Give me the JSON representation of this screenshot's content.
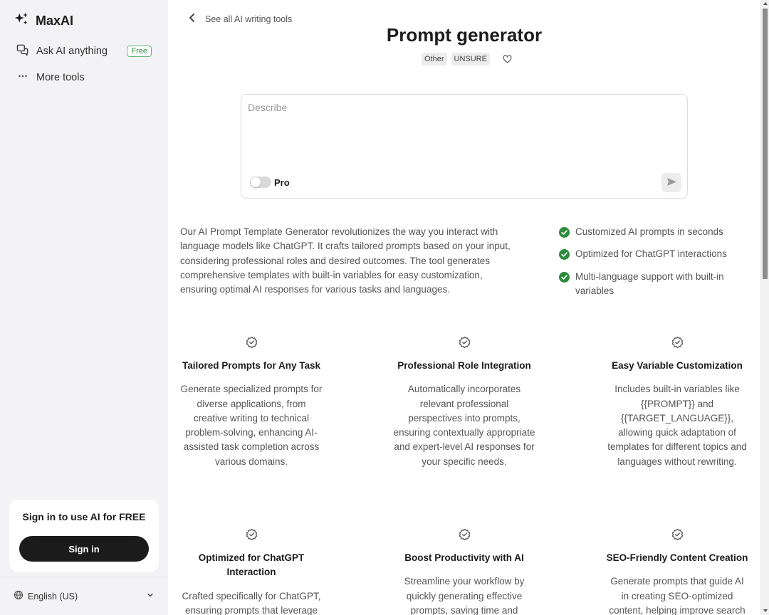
{
  "sidebar": {
    "brand": "MaxAI",
    "nav": [
      {
        "label": "Ask AI anything",
        "badge": "Free"
      },
      {
        "label": "More tools"
      }
    ],
    "signin": {
      "title": "Sign in to use AI for FREE",
      "button": "Sign in"
    },
    "language": "English (US)"
  },
  "header": {
    "back_label": "See all AI writing tools",
    "title": "Prompt generator",
    "tags": [
      "Other",
      "UNSURE"
    ]
  },
  "prompt": {
    "placeholder": "Describe",
    "value": "",
    "pro_label": "Pro",
    "pro_enabled": false
  },
  "intro": "Our AI Prompt Template Generator revolutionizes the way you interact with language models like ChatGPT. It crafts tailored prompts based on your input, considering professional roles and desired outcomes. The tool generates comprehensive templates with built-in variables for easy customization, ensuring optimal AI responses for various tasks and languages.",
  "checklist": [
    "Customized AI prompts in seconds",
    "Optimized for ChatGPT interactions",
    "Multi-language support with built-in variables"
  ],
  "features": [
    {
      "title": "Tailored Prompts for Any Task",
      "desc": "Generate specialized prompts for diverse applications, from creative writing to technical problem-solving, enhancing AI-assisted task completion across various domains."
    },
    {
      "title": "Professional Role Integration",
      "desc": "Automatically incorporates relevant professional perspectives into prompts, ensuring contextually appropriate and expert-level AI responses for your specific needs."
    },
    {
      "title": "Easy Variable Customization",
      "desc": "Includes built-in variables like {{PROMPT}} and {{TARGET_LANGUAGE}}, allowing quick adaptation of templates for different topics and languages without rewriting."
    },
    {
      "title": "Optimized for ChatGPT Interaction",
      "desc": "Crafted specifically for ChatGPT, ensuring prompts that leverage"
    },
    {
      "title": "Boost Productivity with AI",
      "desc": "Streamline your workflow by quickly generating effective prompts, saving time and"
    },
    {
      "title": "SEO-Friendly Content Creation",
      "desc": "Generate prompts that guide AI in creating SEO-optimized content, helping improve search"
    }
  ],
  "colors": {
    "sidebar_bg": "#f3f3f5",
    "check_green": "#2e8b3e",
    "button_dark": "#1b1b1b"
  },
  "icons": {
    "brand": "sparkles-icon",
    "ask": "chat-icon",
    "more": "ellipsis-icon",
    "back": "chevron-left-icon",
    "favorite": "heart-icon",
    "send": "send-icon",
    "check": "check-circle-icon",
    "feature": "badge-check-icon",
    "language": "globe-icon"
  }
}
